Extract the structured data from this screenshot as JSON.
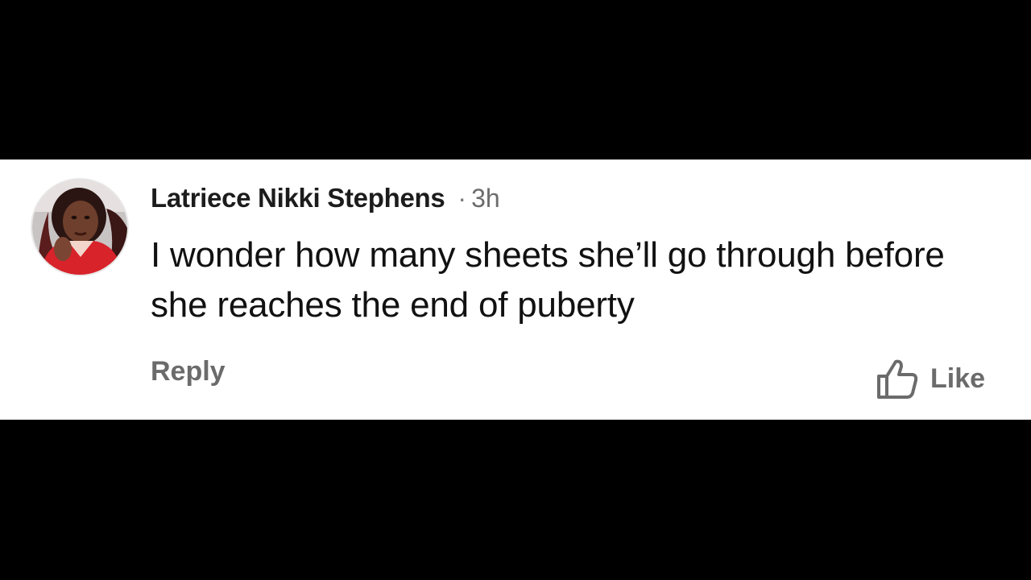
{
  "comment": {
    "author": "Latriece Nikki Stephens",
    "separator": "·",
    "time": "3h",
    "text": "I wonder how many sheets she’ll go through before she reaches the end of puberty",
    "avatar_icon": "profile-photo"
  },
  "actions": {
    "reply_label": "Reply",
    "like_label": "Like",
    "like_icon": "thumbs-up-icon"
  },
  "colors": {
    "background": "#000000",
    "card": "#ffffff",
    "author_text": "#1c1c1c",
    "muted_text": "#6b6b6b",
    "avatar_jacket": "#d8232a"
  }
}
